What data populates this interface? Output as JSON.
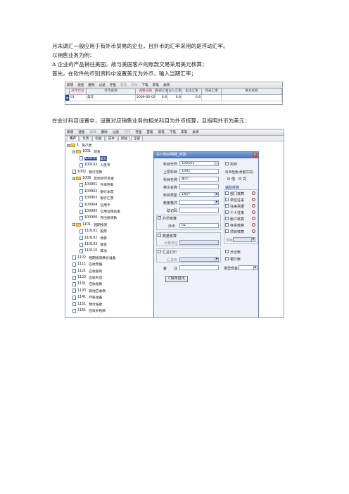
{
  "paragraphs": {
    "p1": "月末调汇一般应用于有外币贸易的企业，且外币的汇率采用的是浮动汇率。",
    "p2": "以销售业务为例：",
    "p3": "A 企业的产品销往美国，故与美国客户的账款交易采用美元核算；",
    "p4": "首先，在软件的币别资料中设置美元为外币，输入当期汇率；",
    "p5": "在会计科目设置中，设置对应销售业务的相关科目为外币核算，且指明外币为美元："
  },
  "screenshot1": {
    "toolbar": [
      "新增",
      "速查",
      "删除",
      "过滤",
      "存盘",
      "首笔",
      "前笔",
      "下笔",
      "末笔",
      "关闭"
    ],
    "toolbar_disabled": [
      5,
      6
    ],
    "headers": [
      "外币代号",
      "外币名称",
      "调整日期",
      "购买汇率",
      "记入汇率",
      "卖出汇率",
      "月末汇率",
      "英文名称"
    ],
    "header_red": [
      0,
      2
    ],
    "row": {
      "marker": "▶",
      "code": "01",
      "name": "美元",
      "date": "2009-06-02",
      "buy": "6.8",
      "book": "6.8",
      "sell": "6.8",
      "month_end": "",
      "english": ""
    }
  },
  "screenshot2": {
    "toolbar": [
      "新增",
      "速查",
      "编辑",
      "删除",
      "过滤",
      "打印",
      "存盘",
      "首笔",
      "前笔",
      "下笔",
      "末笔",
      "关闭"
    ],
    "toolbar_disabled": [
      2,
      5
    ],
    "tabs": [
      "资产",
      "负债",
      "权益",
      "成本",
      "损益",
      "全部"
    ],
    "tree": [
      {
        "code": "1",
        "name": "资产类",
        "type": "folder",
        "box": "−"
      },
      {
        "code": "1001",
        "name": "现金",
        "type": "folder",
        "box": "−"
      },
      {
        "code": "100101",
        "name": "美元",
        "type": "doc",
        "box": "",
        "hl": true
      },
      {
        "code": "100102",
        "name": "人民币",
        "type": "doc",
        "box": ""
      },
      {
        "code": "1002",
        "name": "银行存款",
        "type": "doc",
        "box": ""
      },
      {
        "code": "1009",
        "name": "其他货币资金",
        "type": "folder",
        "box": "−"
      },
      {
        "code": "100901",
        "name": "外埠存款",
        "type": "doc",
        "box": ""
      },
      {
        "code": "100902",
        "name": "银行本票",
        "type": "doc",
        "box": ""
      },
      {
        "code": "100903",
        "name": "银行汇票",
        "type": "doc",
        "box": ""
      },
      {
        "code": "100904",
        "name": "信用卡",
        "type": "doc",
        "box": ""
      },
      {
        "code": "100905",
        "name": "信用证保证金",
        "type": "doc",
        "box": ""
      },
      {
        "code": "100906",
        "name": "存出投资款",
        "type": "doc",
        "box": ""
      },
      {
        "code": "1101",
        "name": "短期投资",
        "type": "folder",
        "box": "−"
      },
      {
        "code": "110101",
        "name": "股票",
        "type": "doc",
        "box": ""
      },
      {
        "code": "110102",
        "name": "债券",
        "type": "doc",
        "box": ""
      },
      {
        "code": "110103",
        "name": "基金",
        "type": "doc",
        "box": ""
      },
      {
        "code": "110110",
        "name": "其他",
        "type": "doc",
        "box": ""
      },
      {
        "code": "1102",
        "name": "短期投资跌价准备",
        "type": "doc",
        "box": ""
      },
      {
        "code": "1111",
        "name": "应收票据",
        "type": "doc",
        "box": ""
      },
      {
        "code": "1121",
        "name": "应收股利",
        "type": "doc",
        "box": ""
      },
      {
        "code": "1122",
        "name": "应收利息",
        "type": "doc",
        "box": ""
      },
      {
        "code": "1131",
        "name": "应收账款",
        "type": "doc",
        "box": ""
      },
      {
        "code": "1133",
        "name": "其他应收款",
        "type": "doc",
        "box": ""
      },
      {
        "code": "1141",
        "name": "坏账准备",
        "type": "doc",
        "box": ""
      },
      {
        "code": "1151",
        "name": "预付账款",
        "type": "doc",
        "box": ""
      },
      {
        "code": "1161",
        "name": "应收补贴款",
        "type": "doc",
        "box": ""
      }
    ],
    "dialog": {
      "title": "会计科目明细_修改",
      "close": "×",
      "code_label": "科目代号",
      "code_value": "100101",
      "parent_label": "上层科目",
      "parent_value": "1001",
      "name_label": "科目名称",
      "name_value": "美元",
      "english_label": "英文名称",
      "english_value": "",
      "category_label": "科目类型",
      "category_value": "1资产",
      "format_label": "帐册格式",
      "format_value": "",
      "mnemonic_label": "助记码",
      "mnemonic_value": "",
      "foreign_check": "外币核算",
      "foreign_checked": "✓",
      "currency_label": "外币",
      "currency_value": "01",
      "quantity_check": "数量核算",
      "unit_label": "计量单位",
      "unit_value": "",
      "summary_check": "汇总打印",
      "summary_to_label": "汇总到",
      "summary_to_value": "",
      "remark_label": "备　　注",
      "remark_value": "",
      "save_button": "C保存退出",
      "freeze_check": "封存",
      "direction_label": "科目性质(余额方向)",
      "debit": "借",
      "credit": "贷",
      "aux_label": "辅助核算",
      "aux_items": [
        "部门核算",
        "单位往来",
        "往来票据",
        "个人往来",
        "帐户核算",
        "存货核算",
        "项目核算"
      ],
      "project_label": "项目",
      "journal_check": "日记帐",
      "bank_check": "银行帐",
      "cashflow_label": "类型现金流"
    }
  }
}
